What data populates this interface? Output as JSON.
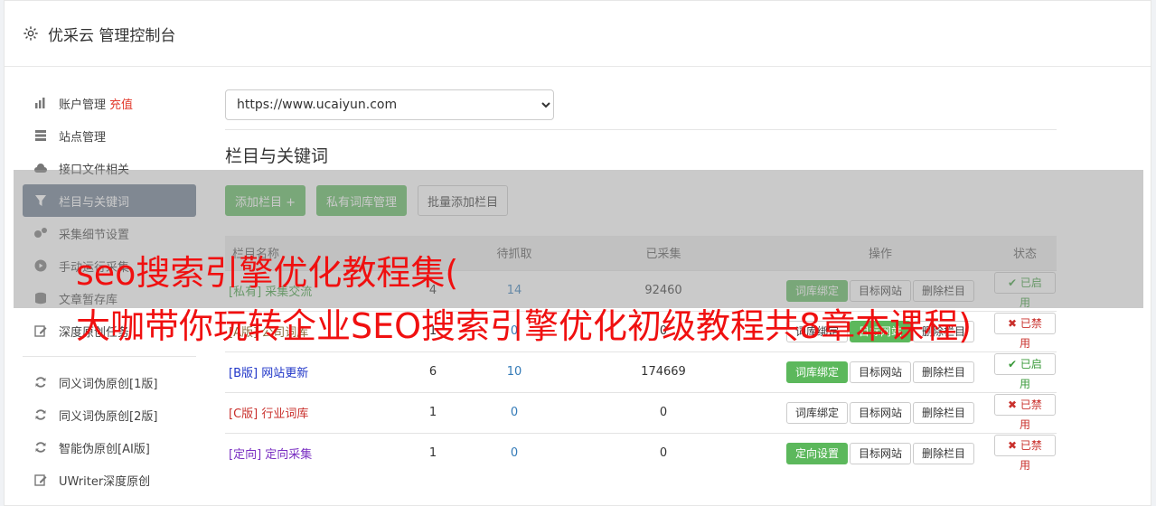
{
  "header": {
    "title": "优采云 管理控制台"
  },
  "sidebar": {
    "group1": [
      {
        "label": "账户管理",
        "extra": "充值",
        "icon": "bar-chart-icon"
      },
      {
        "label": "站点管理",
        "icon": "server-icon"
      },
      {
        "label": "接口文件相关",
        "icon": "cloud-upload-icon"
      },
      {
        "label": "栏目与关键词",
        "icon": "filter-icon",
        "active": true
      },
      {
        "label": "采集细节设置",
        "icon": "gears-icon"
      },
      {
        "label": "手动运行采集",
        "icon": "play-circle-icon"
      },
      {
        "label": "文章暂存库",
        "icon": "database-icon"
      },
      {
        "label": "深度原创任务",
        "icon": "edit-icon"
      }
    ],
    "group2": [
      {
        "label": "同义词伪原创[1版]",
        "icon": "refresh-icon"
      },
      {
        "label": "同义词伪原创[2版]",
        "icon": "refresh-icon"
      },
      {
        "label": "智能伪原创[AI版]",
        "icon": "refresh-icon"
      },
      {
        "label": "UWriter深度原创",
        "icon": "edit-icon"
      }
    ]
  },
  "main": {
    "site_select": "https://www.ucaiyun.com",
    "section_title": "栏目与关键词",
    "buttons": {
      "add": "添加栏目 +",
      "private_lib": "私有词库管理",
      "batch_add": "批量添加栏目"
    },
    "table": {
      "headers": [
        "栏目名称",
        "待抓取",
        "已采集",
        "操作",
        "状态"
      ],
      "rows": [
        {
          "tag": "[私有]",
          "name": "采集交流",
          "pending": "14",
          "collected": "92460",
          "count": "4",
          "op1": "词库绑定",
          "op2": "目标网站",
          "op3": "删除栏目",
          "status": "已启用"
        },
        {
          "tag": "[A版]",
          "name": "公司词库",
          "pending": "0",
          "collected": "0",
          "count": "1",
          "op1": "词库绑定",
          "op2": "目标网站",
          "op3": "删除栏目",
          "status": "已禁用"
        },
        {
          "tag": "[B版]",
          "name": "网站更新",
          "pending": "10",
          "collected": "174669",
          "count": "6",
          "op1": "词库绑定",
          "op2": "目标网站",
          "op3": "删除栏目",
          "status": "已启用"
        },
        {
          "tag": "[C版]",
          "name": "行业词库",
          "pending": "0",
          "collected": "0",
          "count": "1",
          "op1": "词库绑定",
          "op2": "目标网站",
          "op3": "删除栏目",
          "status": "已禁用"
        },
        {
          "tag": "[定向]",
          "name": "定向采集",
          "pending": "0",
          "collected": "0",
          "count": "1",
          "op1": "定向设置",
          "op2": "目标网站",
          "op3": "删除栏目",
          "status": "已禁用"
        }
      ]
    }
  },
  "watermark": {
    "line1": "seo搜索引擎优化教程集(",
    "line2": "大咖带你玩转企业SEO搜索引擎优化初级教程共8章本课程)"
  },
  "colors": {
    "active_nav": "#6b7a8f",
    "green": "#5cb85c",
    "red": "#e23b2e"
  }
}
